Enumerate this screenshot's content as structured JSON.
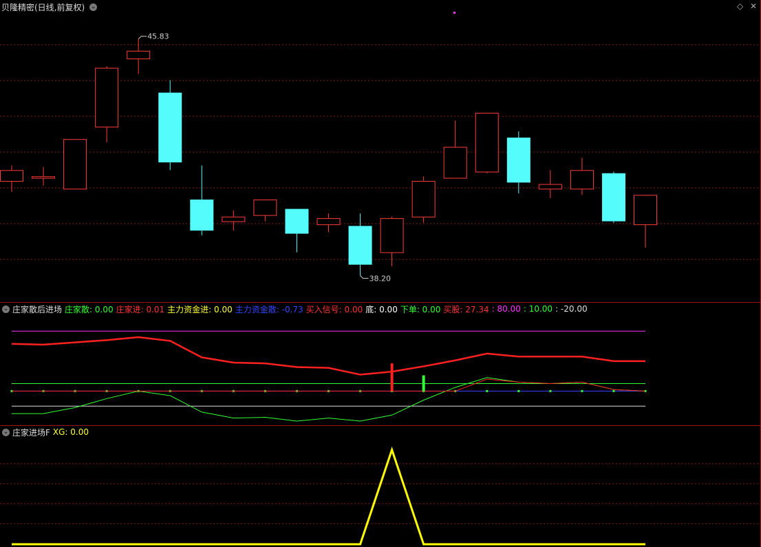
{
  "main_panel": {
    "title": "贝隆精密(日线,前复权)",
    "high_label": "45.83",
    "low_label": "38.20",
    "diamond_icon": "diamond-icon",
    "close_icon": "close-icon"
  },
  "ind1": {
    "name": "庄家散后进场",
    "items": [
      {
        "label": "庄家散: 0.00",
        "color": "#33ff33"
      },
      {
        "label": "庄家进: 0.01",
        "color": "#ff3333"
      },
      {
        "label": "主力资金进: 0.00",
        "color": "#ffff33"
      },
      {
        "label": "主力资金散: -0.73",
        "color": "#3344ff"
      },
      {
        "label": "买入信号: 0.00",
        "color": "#ff3333"
      },
      {
        "label": "底: 0.00",
        "color": "#ffffff"
      },
      {
        "label": "下单: 0.00",
        "color": "#33ff33"
      },
      {
        "label": "买股: 27.34",
        "color": "#ff3333"
      },
      {
        "label": ": 80.00",
        "color": "#ff33ff"
      },
      {
        "label": ": 10.00",
        "color": "#33ff33"
      },
      {
        "label": ": -20.00",
        "color": "#dddddd"
      }
    ]
  },
  "ind2": {
    "name": "庄家进场F",
    "xg_label": "XG: 0.00"
  },
  "colors": {
    "up": "#ff3b3b",
    "down": "#54fcfc",
    "grid": "#8b1a1a",
    "panel_border": "#a01010"
  },
  "chart_data": [
    {
      "type": "candlestick",
      "title": "贝隆精密(日线,前复权)",
      "ylim": [
        37.5,
        46.6
      ],
      "annotations": [
        {
          "text": "45.83",
          "index": 4,
          "kind": "high"
        },
        {
          "text": "38.20",
          "index": 11,
          "kind": "low"
        }
      ],
      "candles": [
        {
          "o": 41.25,
          "h": 41.75,
          "l": 40.9,
          "c": 41.6
        },
        {
          "o": 41.35,
          "h": 41.7,
          "l": 41.1,
          "c": 41.4
        },
        {
          "o": 41.0,
          "h": 42.6,
          "l": 41.0,
          "c": 42.6
        },
        {
          "o": 43.0,
          "h": 44.95,
          "l": 42.5,
          "c": 44.9
        },
        {
          "o": 45.2,
          "h": 45.83,
          "l": 44.7,
          "c": 45.45
        },
        {
          "o": 44.1,
          "h": 44.5,
          "l": 41.6,
          "c": 41.85
        },
        {
          "o": 40.65,
          "h": 41.75,
          "l": 39.5,
          "c": 39.65
        },
        {
          "o": 39.95,
          "h": 40.3,
          "l": 39.65,
          "c": 40.1
        },
        {
          "o": 40.15,
          "h": 40.65,
          "l": 39.95,
          "c": 40.65
        },
        {
          "o": 40.35,
          "h": 40.35,
          "l": 38.95,
          "c": 39.55
        },
        {
          "o": 39.85,
          "h": 40.2,
          "l": 39.6,
          "c": 40.05
        },
        {
          "o": 39.8,
          "h": 40.2,
          "l": 38.2,
          "c": 38.55
        },
        {
          "o": 38.95,
          "h": 40.1,
          "l": 38.5,
          "c": 40.05
        },
        {
          "o": 40.1,
          "h": 41.4,
          "l": 39.9,
          "c": 41.25
        },
        {
          "o": 41.35,
          "h": 43.2,
          "l": 41.7,
          "c": 42.35
        },
        {
          "o": 41.55,
          "h": 43.4,
          "l": 41.5,
          "c": 43.45
        },
        {
          "o": 42.65,
          "h": 42.85,
          "l": 40.85,
          "c": 41.2
        },
        {
          "o": 41.0,
          "h": 41.6,
          "l": 40.7,
          "c": 41.15
        },
        {
          "o": 41.0,
          "h": 42.0,
          "l": 40.8,
          "c": 41.6
        },
        {
          "o": 41.5,
          "h": 41.55,
          "l": 39.9,
          "c": 39.95
        },
        {
          "o": 39.85,
          "h": 40.75,
          "l": 39.1,
          "c": 40.8
        }
      ]
    },
    {
      "type": "line",
      "title": "庄家散后进场",
      "ylim": [
        -40,
        105
      ],
      "reference_lines": [
        {
          "value": 80,
          "color": "#ff33ff"
        },
        {
          "value": 10,
          "color": "#33ff33"
        },
        {
          "value": 0,
          "color": "#3344ff"
        },
        {
          "value": -20,
          "color": "#dddddd"
        }
      ],
      "series": [
        {
          "name": "买股",
          "color": "#ff2020",
          "values": [
            63,
            62,
            65,
            68,
            72,
            67,
            45,
            38,
            37,
            32,
            31,
            22,
            26,
            33,
            41,
            50,
            46,
            46,
            46,
            40,
            40
          ]
        },
        {
          "name": "主力资金进",
          "color": "#33ff33",
          "values": [
            -30,
            -30,
            -22,
            -10,
            0,
            -6,
            -28,
            -36,
            -35,
            -40,
            -36,
            -40,
            -32,
            -12,
            5,
            18,
            12,
            10,
            12,
            2,
            0
          ]
        },
        {
          "name": "主力资金散",
          "color": "#ff2020",
          "values": [
            0,
            0,
            0,
            0,
            0,
            0,
            0,
            0,
            0,
            0,
            0,
            0,
            0,
            0,
            0,
            16,
            12,
            10,
            12,
            2,
            0
          ]
        }
      ],
      "bars": [
        {
          "index": 12,
          "from": 0,
          "to": 37,
          "color": "#ff2020"
        },
        {
          "index": 13,
          "from": 0,
          "to": 21,
          "color": "#33ff33"
        }
      ]
    },
    {
      "type": "line",
      "title": "庄家进场F",
      "ylim": [
        0,
        1.1
      ],
      "series": [
        {
          "name": "XG",
          "color": "#ffff00",
          "values": [
            0,
            0,
            0,
            0,
            0,
            0,
            0,
            0,
            0,
            0,
            0,
            0,
            1,
            0,
            0,
            0,
            0,
            0,
            0,
            0,
            0
          ]
        }
      ]
    }
  ]
}
